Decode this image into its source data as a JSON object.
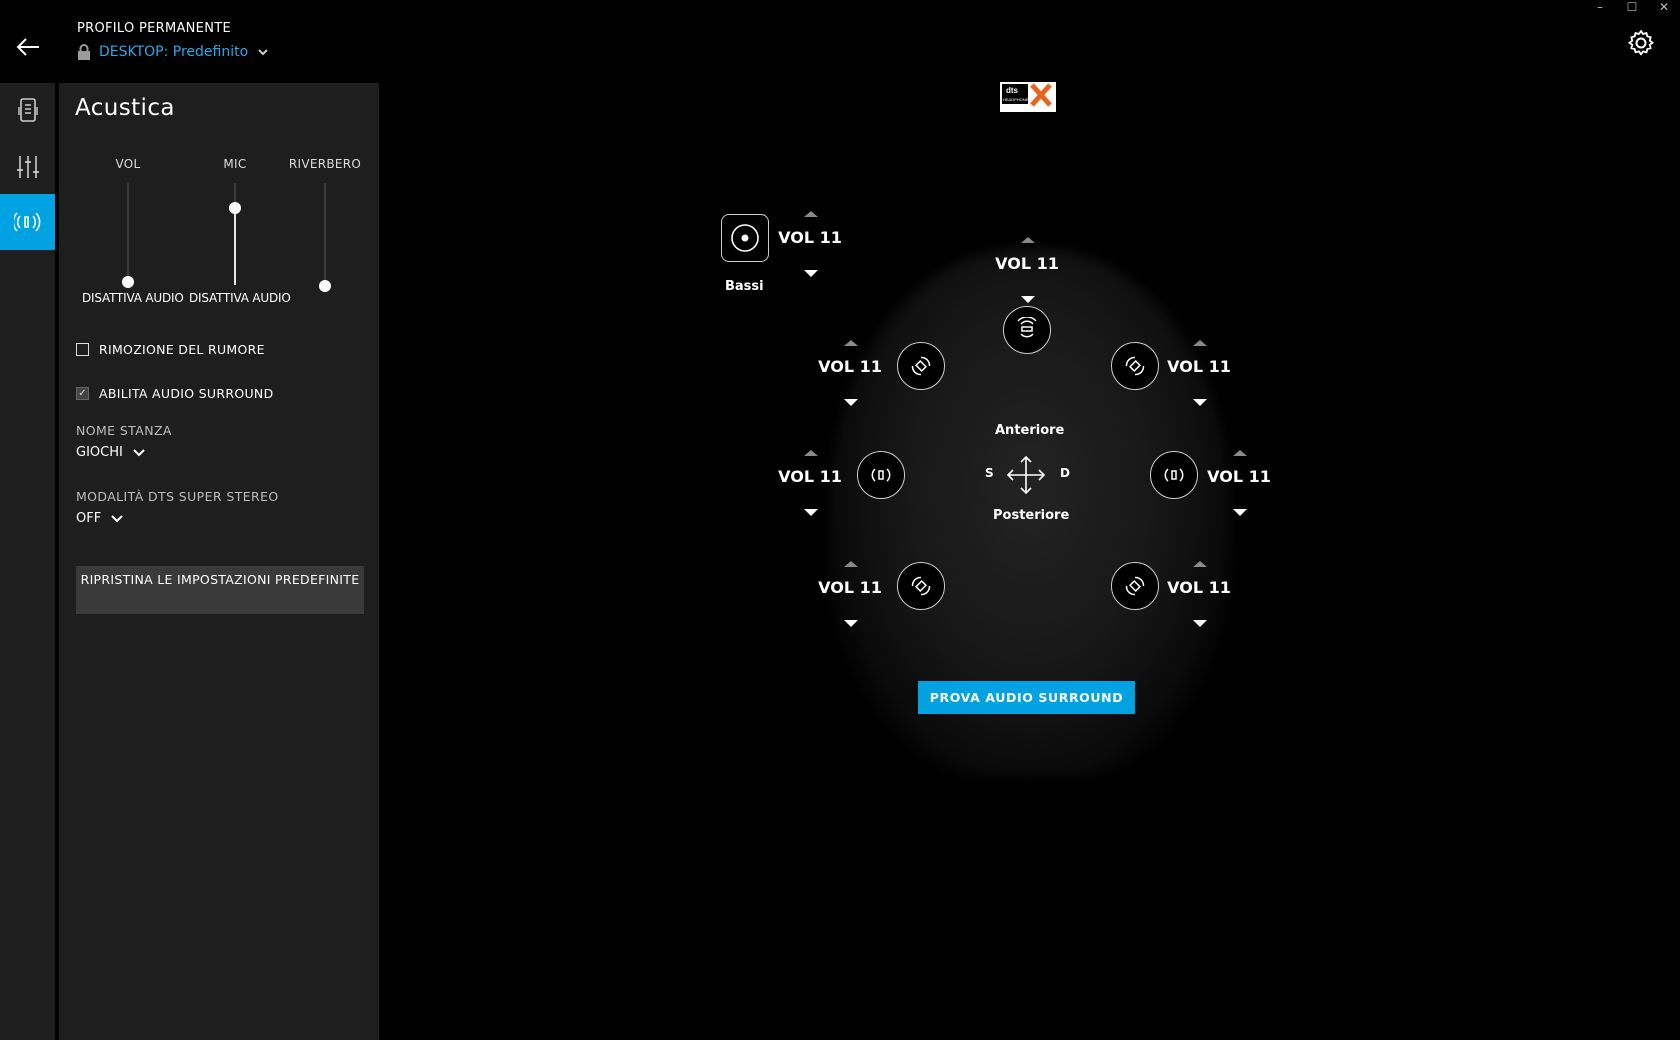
{
  "window": {
    "minimize": "–",
    "maximize": "☐",
    "close": "✕"
  },
  "header": {
    "profile_title": "PROFILO PERMANENTE",
    "profile_name": "DESKTOP: Predefinito"
  },
  "sidebar": {
    "items": [
      {
        "icon": "device-icon"
      },
      {
        "icon": "equalizer-icon"
      },
      {
        "icon": "acoustics-icon",
        "active": true
      }
    ]
  },
  "panel": {
    "title": "Acustica",
    "sliders": [
      {
        "label": "VOL",
        "caption": "DISATTIVA AUDIO",
        "level": 0.0
      },
      {
        "label": "MIC",
        "caption": "DISATTIVA AUDIO",
        "level": 0.75
      },
      {
        "label": "RIVERBERO",
        "caption": "",
        "level": 0.0
      }
    ],
    "noise_removal": {
      "label": "RIMOZIONE DEL RUMORE",
      "checked": false
    },
    "surround": {
      "label": "ABILITA AUDIO SURROUND",
      "checked": true
    },
    "room": {
      "label": "NOME STANZA",
      "value": "GIOCHI"
    },
    "dts_mode": {
      "label": "MODALITÀ DTS SUPER STEREO",
      "value": "OFF"
    },
    "reset_button": "RIPRISTINA LE IMPOSTAZIONI PREDEFINITE"
  },
  "surround": {
    "bass": {
      "label": "Bassi",
      "volume": "VOL 11"
    },
    "front_center": "VOL 11",
    "front_left": "VOL 11",
    "front_right": "VOL 11",
    "side_left": "VOL 11",
    "side_right": "VOL 11",
    "rear_left": "VOL 11",
    "rear_right": "VOL 11",
    "front_label": "Anteriore",
    "rear_label": "Posteriore",
    "left_label": "S",
    "right_label": "D",
    "test_button": "PROVA AUDIO SURROUND"
  },
  "colors": {
    "accent": "#00a2e1",
    "panel": "#1e1e1e",
    "link": "#2fa6e6"
  }
}
